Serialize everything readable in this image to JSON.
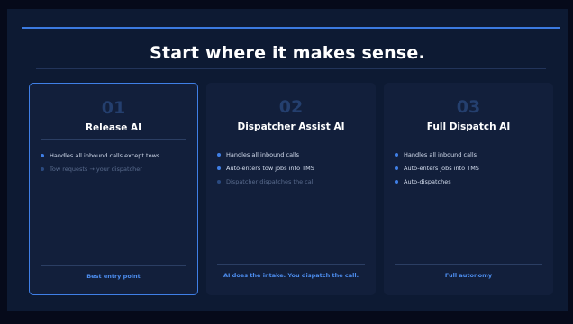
{
  "title": "Start where it makes sense.",
  "colors": {
    "accent": "#3f7fe6",
    "background": "#0d1a33",
    "card": "#121f3b",
    "muted_text": "#5a6c8e"
  },
  "cards": [
    {
      "number": "01",
      "name": "Release AI",
      "selected": true,
      "bullets": [
        {
          "text": "Handles all inbound calls except tows",
          "muted": false
        },
        {
          "text": "Tow requests → your dispatcher",
          "muted": true
        }
      ],
      "footer": "Best entry point"
    },
    {
      "number": "02",
      "name": "Dispatcher Assist AI",
      "selected": false,
      "bullets": [
        {
          "text": "Handles all inbound calls",
          "muted": false
        },
        {
          "text": "Auto-enters tow jobs into TMS",
          "muted": false
        },
        {
          "text": "Dispatcher dispatches the call",
          "muted": true
        }
      ],
      "footer": "AI does the intake. You dispatch the call."
    },
    {
      "number": "03",
      "name": "Full Dispatch AI",
      "selected": false,
      "bullets": [
        {
          "text": "Handles all inbound calls",
          "muted": false
        },
        {
          "text": "Auto-enters jobs into TMS",
          "muted": false
        },
        {
          "text": "Auto-dispatches",
          "muted": false
        }
      ],
      "footer": "Full autonomy"
    }
  ]
}
